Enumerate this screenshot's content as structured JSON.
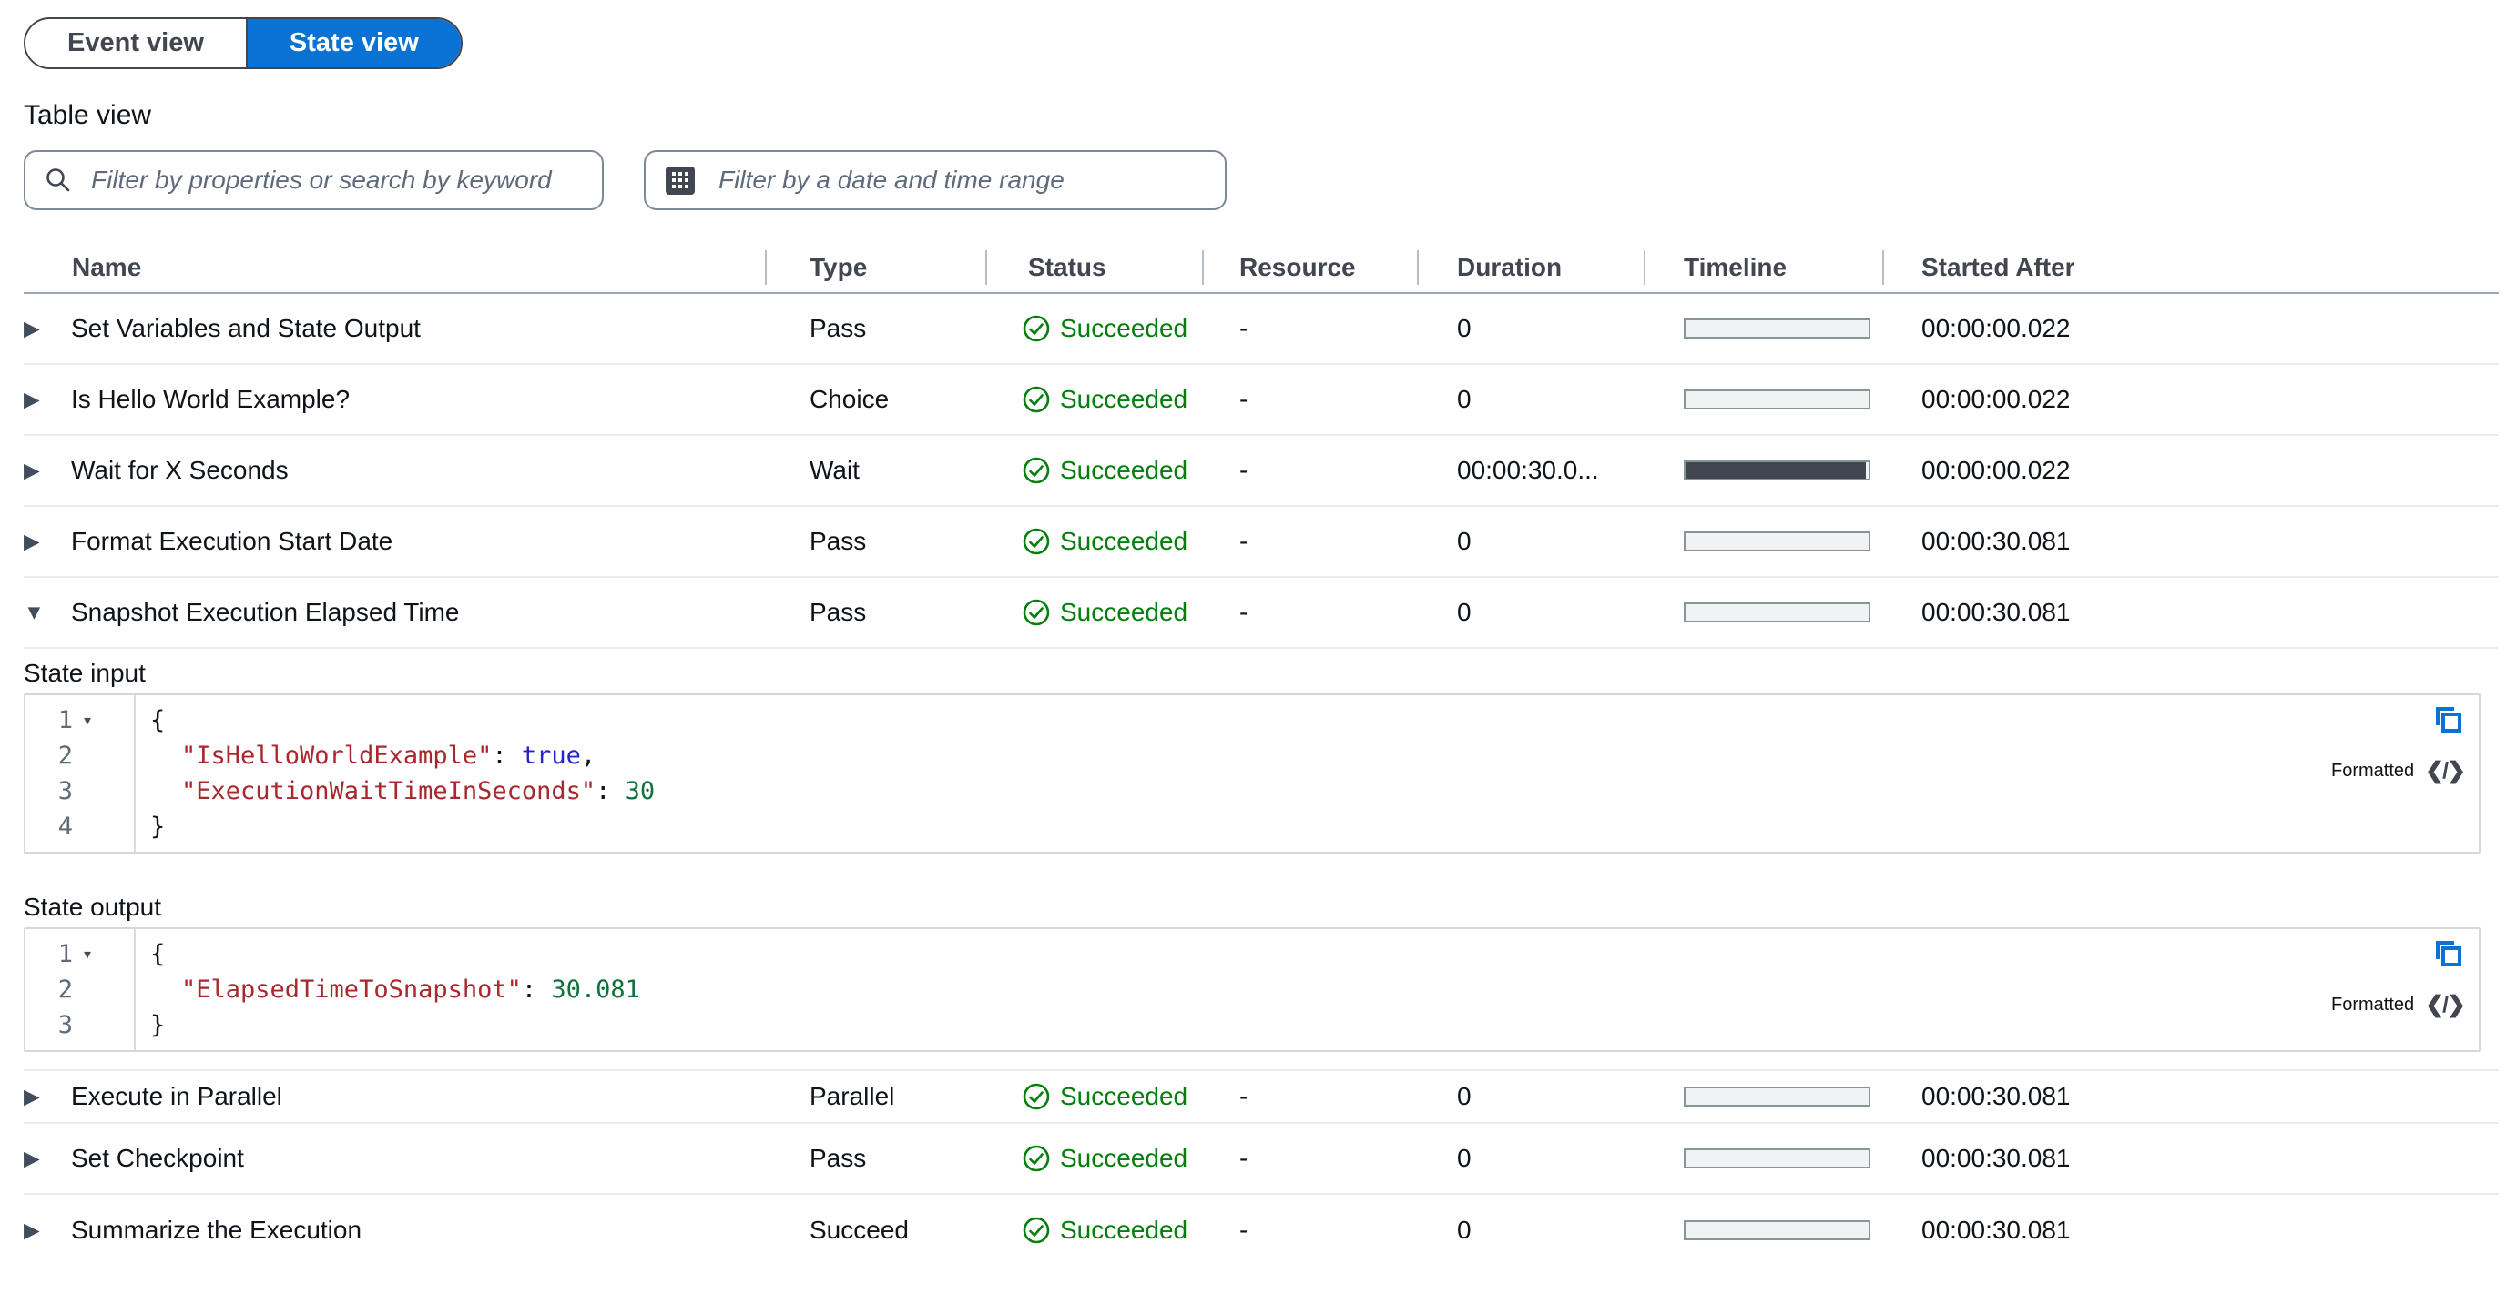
{
  "toggle": {
    "event_view": "Event view",
    "state_view": "State view"
  },
  "heading": "Table view",
  "filters": {
    "search": {
      "placeholder": "Filter by properties or search by keyword"
    },
    "date_range": {
      "placeholder": "Filter by a date and time range"
    }
  },
  "colors": {
    "accent": "#0972d3",
    "success": "#037f0c",
    "timeline_bar_fill": "#424650",
    "json_key": "#a8282d",
    "json_boolean": "#2525c9",
    "json_number": "#13713d"
  },
  "table": {
    "columns": [
      "Name",
      "Type",
      "Status",
      "Resource",
      "Duration",
      "Timeline",
      "Started After"
    ],
    "rows": [
      {
        "expand_glyph": "▶",
        "name": "Set Variables and State Output",
        "type": "Pass",
        "status": "Succeeded",
        "resource": "-",
        "duration": "0",
        "timeline_filled": false,
        "started_after": "00:00:00.022"
      },
      {
        "expand_glyph": "▶",
        "name": "Is Hello World Example?",
        "type": "Choice",
        "status": "Succeeded",
        "resource": "-",
        "duration": "0",
        "timeline_filled": false,
        "started_after": "00:00:00.022"
      },
      {
        "expand_glyph": "▶",
        "name": "Wait for X Seconds",
        "type": "Wait",
        "status": "Succeeded",
        "resource": "-",
        "duration": "00:00:30.0...",
        "timeline_filled": true,
        "started_after": "00:00:00.022"
      },
      {
        "expand_glyph": "▶",
        "name": "Format Execution Start Date",
        "type": "Pass",
        "status": "Succeeded",
        "resource": "-",
        "duration": "0",
        "timeline_filled": false,
        "started_after": "00:00:30.081"
      },
      {
        "expand_glyph": "▼",
        "name": "Snapshot Execution Elapsed Time",
        "type": "Pass",
        "status": "Succeeded",
        "resource": "-",
        "duration": "0",
        "timeline_filled": false,
        "started_after": "00:00:30.081",
        "expanded": true
      },
      {
        "expand_glyph": "▶",
        "name": "Execute in Parallel",
        "type": "Parallel",
        "status": "Succeeded",
        "resource": "-",
        "duration": "0",
        "timeline_filled": false,
        "started_after": "00:00:30.081"
      },
      {
        "expand_glyph": "▶",
        "name": "Set Checkpoint",
        "type": "Pass",
        "status": "Succeeded",
        "resource": "-",
        "duration": "0",
        "timeline_filled": false,
        "started_after": "00:00:30.081"
      },
      {
        "expand_glyph": "▶",
        "name": "Summarize the Execution",
        "type": "Succeed",
        "status": "Succeeded",
        "resource": "-",
        "duration": "0",
        "timeline_filled": false,
        "started_after": "00:00:30.081"
      }
    ]
  },
  "state_input": {
    "heading": "State input",
    "formatted_label": "Formatted",
    "code_icon": "❮/❯",
    "lines": {
      "l1": {
        "num": "1",
        "fold": "▾",
        "open": "{"
      },
      "l2": {
        "num": "2",
        "key": "\"IsHelloWorldExample\"",
        "colon": ": ",
        "value": "true",
        "comma": ","
      },
      "l3": {
        "num": "3",
        "key": "\"ExecutionWaitTimeInSeconds\"",
        "colon": ": ",
        "value": "30"
      },
      "l4": {
        "num": "4",
        "close": "}"
      }
    }
  },
  "state_output": {
    "heading": "State output",
    "formatted_label": "Formatted",
    "code_icon": "❮/❯",
    "lines": {
      "l1": {
        "num": "1",
        "fold": "▾",
        "open": "{"
      },
      "l2": {
        "num": "2",
        "key": "\"ElapsedTimeToSnapshot\"",
        "colon": ": ",
        "value": "30.081"
      },
      "l3": {
        "num": "3",
        "close": "}"
      }
    }
  }
}
